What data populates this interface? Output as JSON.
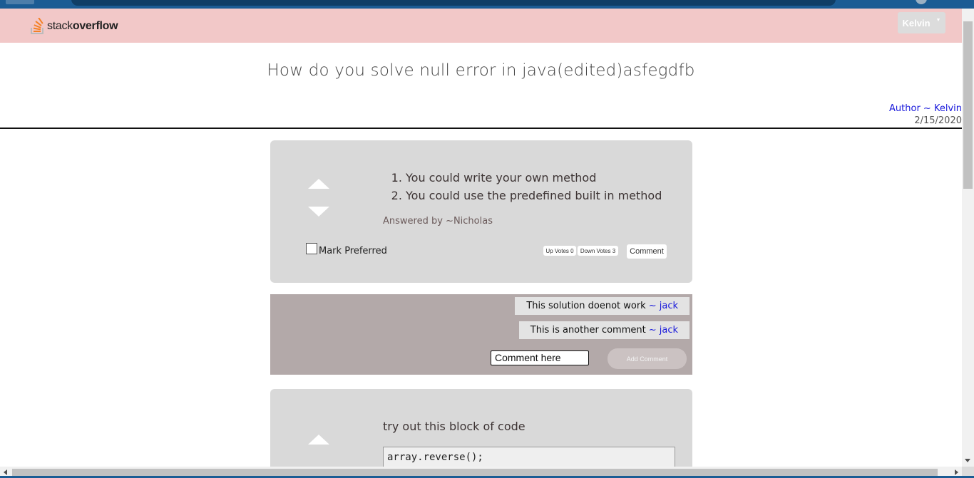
{
  "brand": {
    "logo_text_light": "stack",
    "logo_text_bold": "overflow",
    "accent": "#f48024"
  },
  "user_menu": {
    "label": "Kelvin"
  },
  "question": {
    "title": "How do you solve null error in java(edited)asfegdfb",
    "author": "Author ~ Kelvin",
    "date": "2/15/2020"
  },
  "answers": [
    {
      "items": [
        "You could write your own method",
        "You could use the predefined built in method"
      ],
      "answered_by": "Answered by ~Nicholas",
      "mark_preferred_label": "Mark Preferred",
      "mark_preferred_checked": false,
      "up_votes_label": "Up Votes 0",
      "down_votes_label": "Down Votes 3",
      "comment_button_label": "Comment"
    },
    {
      "text": "try out this block of code",
      "code": "array.reverse();"
    }
  ],
  "comments": [
    {
      "text": "This solution doenot work",
      "author": "~ jack"
    },
    {
      "text": "This is another comment",
      "author": "~ jack"
    }
  ],
  "comment_form": {
    "value": "Comment here",
    "submit_label": "Add Comment"
  }
}
